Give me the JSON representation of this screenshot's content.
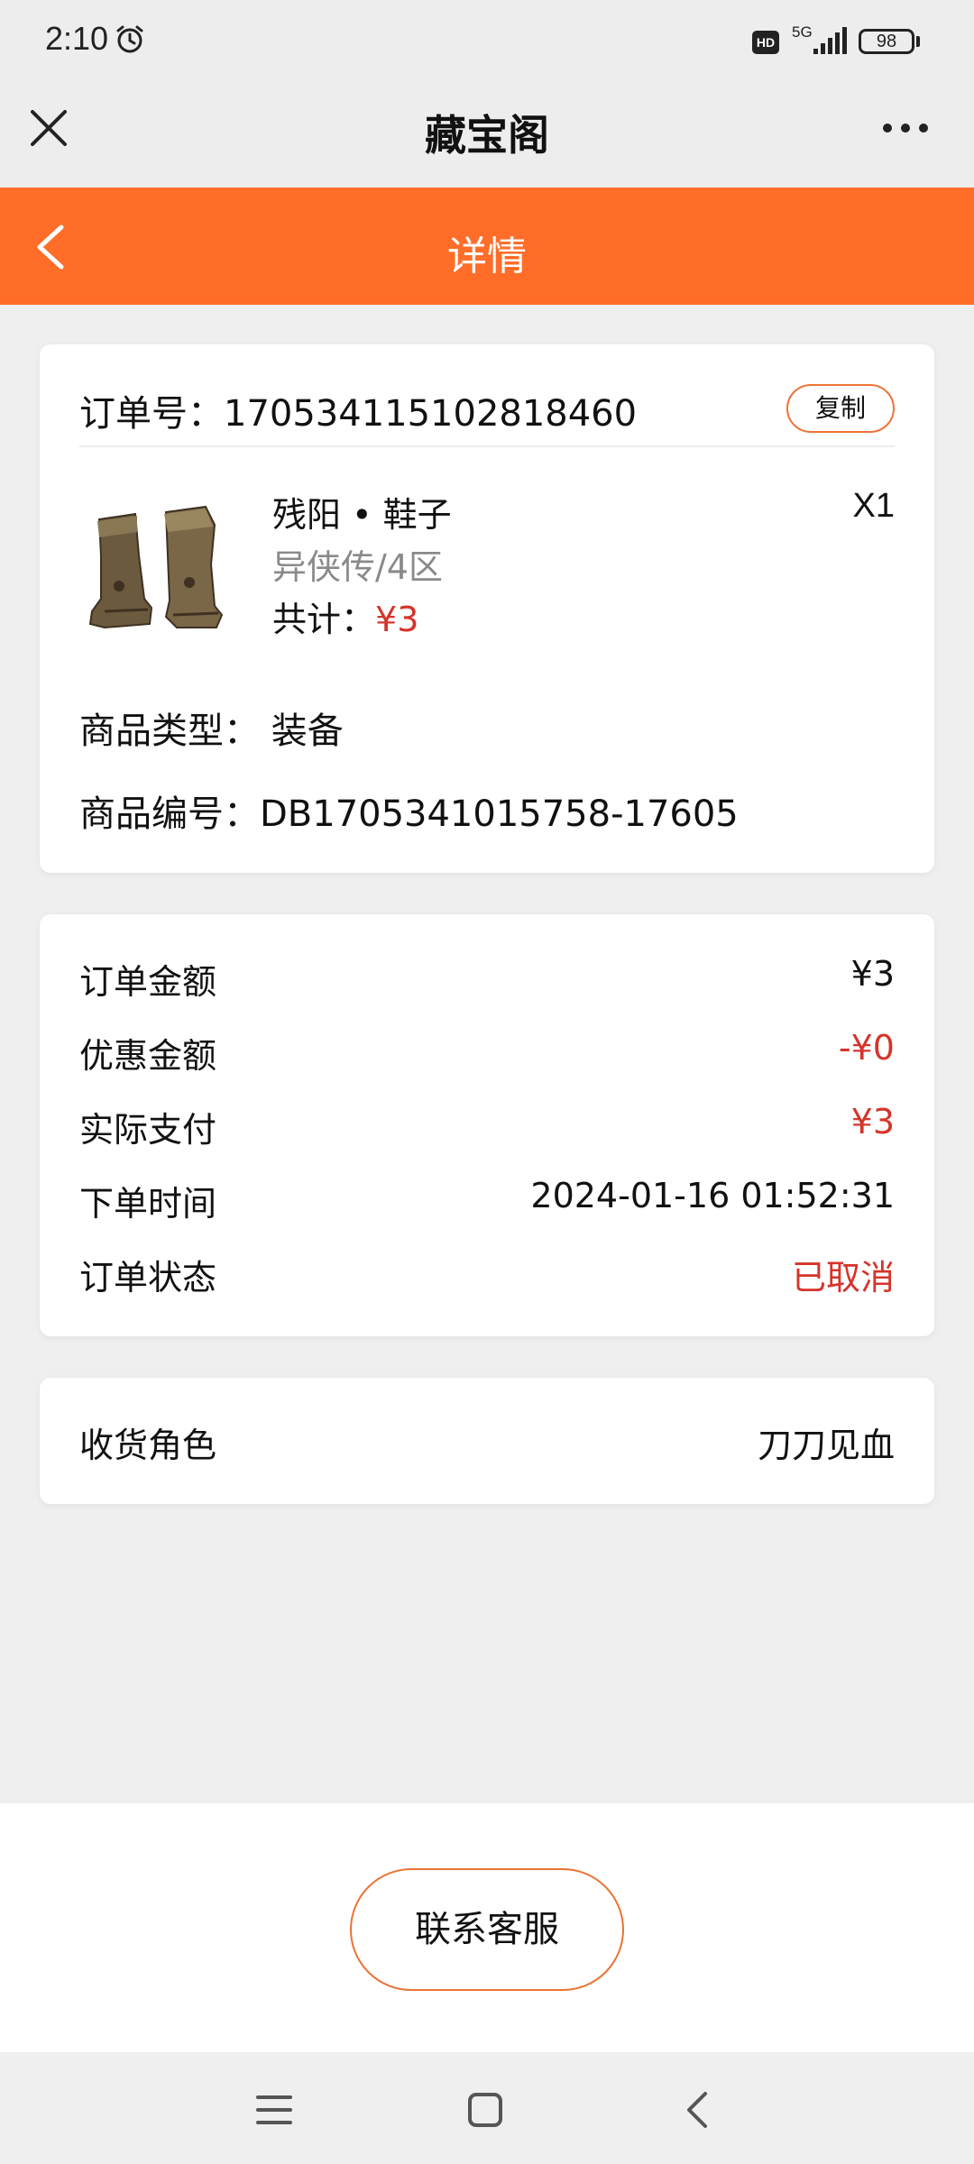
{
  "status_bar": {
    "time": "2:10",
    "network": "5G",
    "battery": "98",
    "hd_label": "HD"
  },
  "header": {
    "title": "藏宝阁"
  },
  "nav": {
    "title": "详情"
  },
  "order": {
    "order_no_text": "订单号：170534115102818460",
    "copy_label": "复制",
    "product_name": "残阳 • 鞋子",
    "quantity": "X1",
    "server": "异侠传/4区",
    "total_label": "共计：",
    "total_value": "¥3",
    "type_text": "商品类型：  装备",
    "item_no_text": "商品编号：DB1705341015758-17605"
  },
  "summary": {
    "rows": [
      {
        "label": "订单金额",
        "value": "¥3"
      },
      {
        "label": "优惠金额",
        "value": "-¥0"
      },
      {
        "label": "实际支付",
        "value": "¥3"
      },
      {
        "label": "下单时间",
        "value": "2024-01-16 01:52:31"
      },
      {
        "label": "订单状态",
        "value": "已取消"
      }
    ]
  },
  "receiver": {
    "label": "收货角色",
    "value": "刀刀见血"
  },
  "footer": {
    "contact_label": "联系客服"
  },
  "colors": {
    "accent": "#ff6d29",
    "price_red": "#d5342b"
  },
  "icons": {
    "close": "close-icon",
    "more": "more-icon",
    "back": "back-icon",
    "menu": "menu-icon",
    "home": "home-icon",
    "nav_back": "nav-back-icon"
  }
}
